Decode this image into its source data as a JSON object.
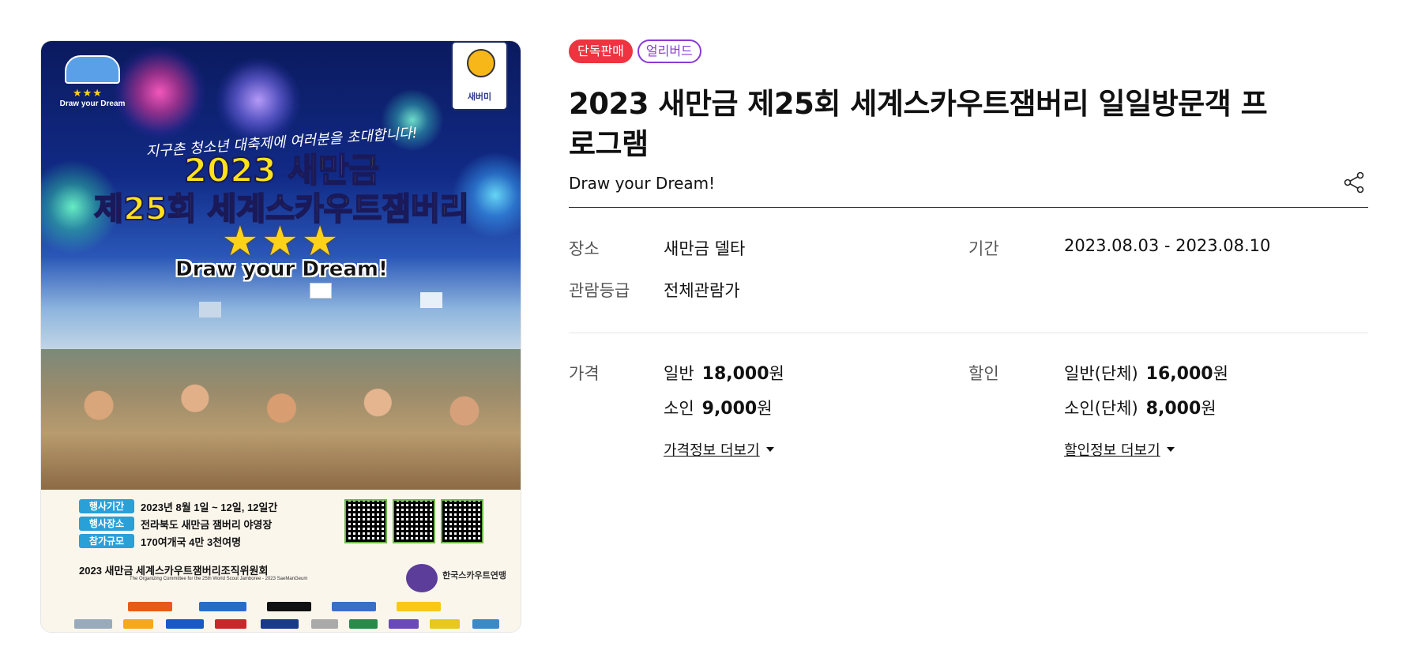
{
  "poster": {
    "logo_text": "Draw your Dream",
    "mascot_text": "새버미",
    "tagline": "지구촌 청소년 대축제에 여러분을 초대합니다!",
    "headline1": "2023 새만금",
    "headline2": "제25회 세계스카우트잼버리",
    "stars": "★★★",
    "slogan": "Draw your Dream!",
    "info": [
      {
        "tag": "행사기간",
        "text": "2023년 8월 1일 ~ 12일, 12일간"
      },
      {
        "tag": "행사장소",
        "text": "전라북도 새만금 잼버리 야영장"
      },
      {
        "tag": "참가규모",
        "text": "170여개국 4만 3천여명"
      }
    ],
    "organizer": "2023 새만금 세계스카우트잼버리조직위원회",
    "organizer_en": "The Organizing Committee for the 25th World Scout Jamboree - 2023 SaeManGeum",
    "ksa": "한국스카우트연맹"
  },
  "badges": {
    "exclusive": "단독판매",
    "early": "얼리버드"
  },
  "title": "2023 새만금 제25회 세계스카우트잼버리 일일방문객 프로그램",
  "subtitle": "Draw your Dream!",
  "icons": {
    "share": "share-icon",
    "caret": "caret-down-icon"
  },
  "details": {
    "venue_label": "장소",
    "venue_value": "새만금 델타",
    "period_label": "기간",
    "period_value": "2023.08.03 - 2023.08.10",
    "rating_label": "관람등급",
    "rating_value": "전체관람가"
  },
  "pricing": {
    "price_label": "가격",
    "discount_label": "할인",
    "prices": [
      {
        "type": "일반",
        "amount": "18,000",
        "unit": "원"
      },
      {
        "type": "소인",
        "amount": "9,000",
        "unit": "원"
      }
    ],
    "discounts": [
      {
        "type": "일반(단체)",
        "amount": "16,000",
        "unit": "원"
      },
      {
        "type": "소인(단체)",
        "amount": "8,000",
        "unit": "원"
      }
    ],
    "price_more": "가격정보 더보기",
    "discount_more": "할인정보 더보기"
  },
  "colors": {
    "exclusive_badge": "#ef3340",
    "early_badge": "#8a3ad8"
  }
}
